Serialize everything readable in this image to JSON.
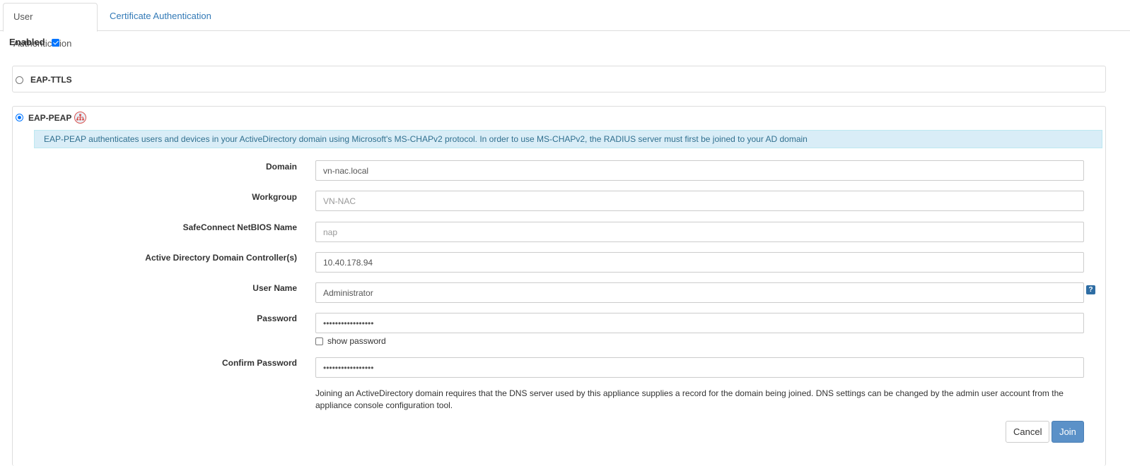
{
  "tabs": [
    {
      "label": "User Authentication",
      "active": true
    },
    {
      "label": "Certificate Authentication",
      "active": false
    }
  ],
  "enabled": {
    "label": "Enabled",
    "checked": true
  },
  "ttls": {
    "label": "EAP-TTLS",
    "selected": false
  },
  "peap": {
    "label": "EAP-PEAP",
    "selected": true,
    "icon": "network-icon",
    "info": "EAP-PEAP authenticates users and devices in your ActiveDirectory domain using Microsoft's MS-CHAPv2 protocol. In order to use MS-CHAPv2, the RADIUS server must first be joined to your AD domain"
  },
  "form": {
    "domain": {
      "label": "Domain",
      "value": "vn-nac.local",
      "placeholder": ""
    },
    "workgroup": {
      "label": "Workgroup",
      "value": "",
      "placeholder": "VN-NAC"
    },
    "netbios": {
      "label": "SafeConnect NetBIOS Name",
      "value": "",
      "placeholder": "nap"
    },
    "dc": {
      "label": "Active Directory Domain Controller(s)",
      "value": "10.40.178.94",
      "placeholder": ""
    },
    "username": {
      "label": "User Name",
      "value": "Administrator",
      "placeholder": ""
    },
    "password": {
      "label": "Password",
      "value": "•••••••••••••••••"
    },
    "show_password": {
      "label": "show password",
      "checked": false
    },
    "confirm_password": {
      "label": "Confirm Password",
      "value": "•••••••••••••••••"
    }
  },
  "help_icon": "?",
  "note": "Joining an ActiveDirectory domain requires that the DNS server used by this appliance supplies a record for the domain being joined. DNS settings can be changed by the admin user account from the appliance console configuration tool.",
  "buttons": {
    "cancel": "Cancel",
    "join": "Join"
  },
  "colors": {
    "accent": "#337ab7",
    "info_bg": "#d9edf7",
    "info_text": "#31708f",
    "join_bg": "#5b91c8"
  }
}
